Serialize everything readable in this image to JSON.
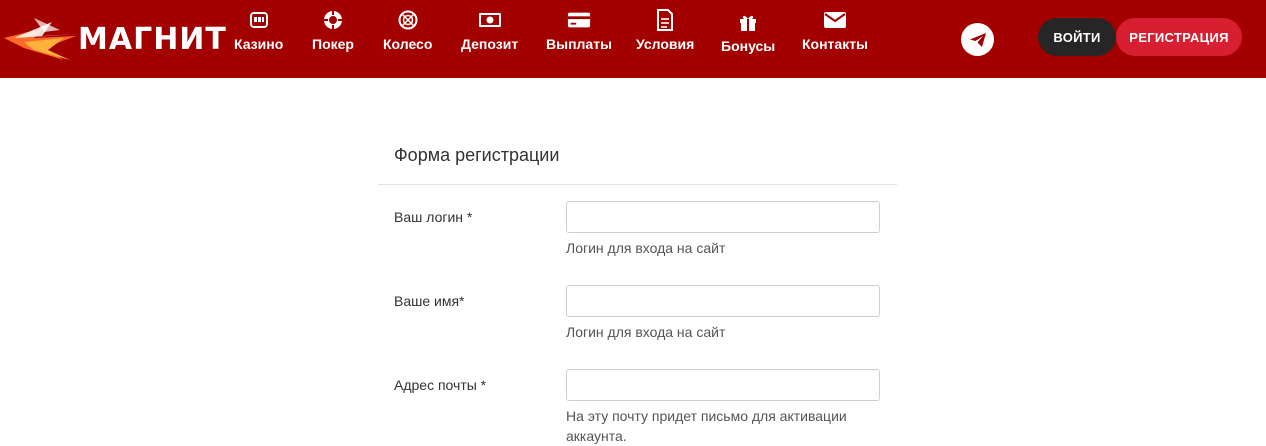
{
  "header": {
    "logo_text": "МАГНИТ",
    "nav": [
      {
        "label": "Казино",
        "icon": "slot-machine-icon"
      },
      {
        "label": "Покер",
        "icon": "poker-chip-icon"
      },
      {
        "label": "Колесо",
        "icon": "wheel-icon"
      },
      {
        "label": "Депозит",
        "icon": "banknote-icon"
      },
      {
        "label": "Выплаты",
        "icon": "credit-card-icon"
      },
      {
        "label": "Условия",
        "icon": "document-icon"
      },
      {
        "label": "Бонусы",
        "icon": "gift-icon"
      },
      {
        "label": "Контакты",
        "icon": "envelope-icon"
      }
    ],
    "login_label": "ВОЙТИ",
    "register_label": "РЕГИСТРАЦИЯ"
  },
  "colors": {
    "header_bg": "#a30000",
    "login_bg": "#262626",
    "register_bg": "#d81f31"
  },
  "form": {
    "title": "Форма регистрации",
    "fields": [
      {
        "label": "Ваш логин *",
        "value": "",
        "hint": "Логин для входа на сайт"
      },
      {
        "label": "Ваше имя*",
        "value": "",
        "hint": "Логин для входа на сайт"
      },
      {
        "label": "Адрес почты *",
        "value": "",
        "hint": "На эту почту придет письмо для активации аккаунта."
      }
    ]
  }
}
